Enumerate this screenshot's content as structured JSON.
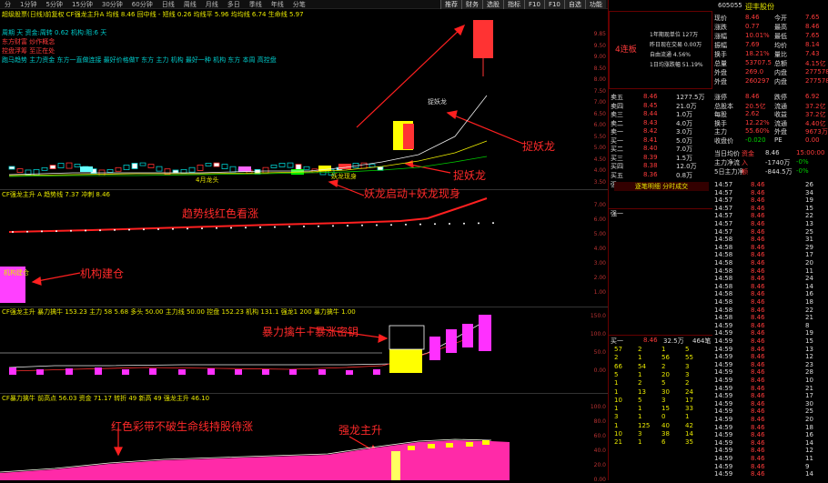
{
  "topbar": {
    "tabs": [
      "分",
      "1分钟",
      "5分钟",
      "15分钟",
      "30分钟",
      "60分钟",
      "日线",
      "周线",
      "月线",
      "多日",
      "季线",
      "年线",
      "分笔",
      "盘面",
      "更多"
    ]
  },
  "toolbar": [
    "推荐",
    "财务",
    "选股",
    "指标",
    "F10",
    "F10",
    "自选",
    "功能"
  ],
  "stock": {
    "code": "605055",
    "name": "迎丰股份"
  },
  "main_legend": {
    "line1": "超级股票(日线)前复权 CF强龙主升A 均线 8.46 回中线 - 短线 0.26 均线平 5.96 均均线 6.74 生命线 5.97",
    "lines": [
      "周期 天 资金:周转 0.62 机构:阻:6 天",
      "东方财富 炒作概念",
      "控盘浮筹 至正在处",
      "跑马趋势 主力资金 东方一直做连接 最好价格做T 东方 主力 机构 最好一种 机构 东方 本周 高控盘"
    ]
  },
  "price_axis": [
    "9.85",
    "9.50",
    "9.00",
    "8.50",
    "8.00",
    "7.50",
    "7.00",
    "6.50",
    "6.00",
    "5.50",
    "5.00",
    "4.50",
    "4.00",
    "3.50"
  ],
  "sub1_legend": "CF强龙主升 A 趋势线 7.37 冲刺 8.46",
  "sub1_axis": [
    "7.00",
    "6.00",
    "5.00",
    "4.00",
    "3.00",
    "2.00",
    "1.00"
  ],
  "sub2_legend": "CF强龙主升 暴力擒牛 153.23 主力 58 5.68 多头 50.00 主力线 50.00 控盘 152.23 机构 131.1 强龙1 200 暴力擒牛 1.00",
  "sub2_axis": [
    "150.0",
    "100.0",
    "50.0",
    "0.00"
  ],
  "sub3_legend": "CF暴力擒牛 前高点 56.03 资金 71.17 转折 49 新高 49 强龙主升 46.10",
  "sub3_axis": [
    "100.0",
    "80.0",
    "60.0",
    "40.0",
    "20.0",
    "0.00"
  ],
  "annotations": {
    "zhuoyaolong": "捉妖龙",
    "yaolongqidong": "妖龙启动+妖龙现身",
    "qushixian": "趋势线红色看涨",
    "jigoujiancang": "机构建仓",
    "baoli": "暴力擒牛+暴涨密钥",
    "hongse": "红色彩带不破生命线持股待涨",
    "qianglong": "强龙主升",
    "chart_small1": "4月龙头",
    "chart_small2": "妖龙现身",
    "chart_small3": "主力建仓",
    "chart_small4": "机构建仓",
    "zhuoyaolong_small": "捉妖龙",
    "tag_zhangting": "4连板"
  },
  "right": {
    "header_left": {
      "label": "4连板"
    },
    "header_info": [
      "1年期现单位 127万",
      "昨日现在交易 0.00万",
      "自由流通 4.56%",
      "1日均涨跌幅 51.19%"
    ],
    "quote": [
      [
        "现价",
        "8.46",
        "今开",
        "7.65"
      ],
      [
        "涨跌",
        "0.77",
        "最高",
        "8.46"
      ],
      [
        "涨幅",
        "10.01%",
        "最低",
        "7.65"
      ],
      [
        "振幅",
        "7.69",
        "均价",
        "8.14"
      ],
      [
        "换手",
        "18.21%",
        "量比",
        "7.43"
      ],
      [
        "总量",
        "53707.5",
        "总额",
        "4.15亿"
      ],
      [
        "外盘",
        "269.0",
        "内盘",
        "277578"
      ],
      [
        "外盘",
        "260297",
        "内盘",
        "277578"
      ]
    ],
    "asks": [
      [
        "卖五",
        "8.46",
        "1277.5万"
      ],
      [
        "卖四",
        "8.45",
        "21.0万"
      ],
      [
        "卖三",
        "8.44",
        "1.0万"
      ],
      [
        "卖二",
        "8.43",
        "4.0万"
      ],
      [
        "卖一",
        "8.42",
        "3.0万"
      ],
      [
        "买一",
        "8.41",
        "5.0万"
      ],
      [
        "买二",
        "8.40",
        "7.0万"
      ],
      [
        "买三",
        "8.39",
        "1.5万"
      ],
      [
        "买四",
        "8.38",
        "12.0万"
      ],
      [
        "买五",
        "8.36",
        "0.8万"
      ]
    ],
    "stats": [
      [
        "涨停",
        "8.46",
        "跌停",
        "6.92"
      ],
      [
        "总股本",
        "20.5亿",
        "流通",
        "37.2亿"
      ],
      [
        "每股",
        "2.62",
        "收益",
        "37.2亿"
      ],
      [
        "换手",
        "12.22%",
        "流通",
        "4.40亿"
      ],
      [
        "主力",
        "55.60%",
        "外盘",
        "9673万"
      ],
      [
        "收盘价",
        "-0.020",
        "PE",
        "0.00"
      ]
    ],
    "stats2": [
      [
        "当日均价",
        "资金",
        "8.46",
        "15:00:00"
      ],
      [
        "主力净流",
        "入",
        "-1740万",
        "-0%"
      ],
      [
        "5日主力净",
        "额",
        "-844.5万",
        "-0%"
      ]
    ],
    "tradetab": "逐笔明细 分时成交",
    "ticks_time": [
      "14:57",
      "14:57",
      "14:57",
      "14:57",
      "14:57",
      "14:57",
      "14:57",
      "14:58",
      "14:58",
      "14:58",
      "14:58",
      "14:58",
      "14:58",
      "14:58",
      "14:58",
      "14:58",
      "14:58",
      "14:58",
      "14:59",
      "14:59",
      "14:59",
      "14:59",
      "14:59",
      "14:59",
      "14:59",
      "14:59",
      "14:59",
      "14:59",
      "14:59",
      "14:59",
      "14:59",
      "14:59",
      "14:59",
      "14:59",
      "14:59",
      "14:59",
      "14:59",
      "14:59"
    ],
    "ticks_price": "8.46",
    "ticks_vol": [
      "26",
      "34",
      "19",
      "15",
      "22",
      "13",
      "25",
      "31",
      "29",
      "17",
      "20",
      "11",
      "24",
      "14",
      "16",
      "18",
      "22",
      "21",
      "8",
      "19",
      "15",
      "13",
      "12",
      "23",
      "28",
      "10",
      "21",
      "17",
      "30",
      "25",
      "20",
      "18",
      "16",
      "14",
      "12",
      "11",
      "9",
      "14"
    ],
    "mid_label": "强一",
    "bid_box": {
      "title": "买一",
      "price": "8.46",
      "vol": "32.5万",
      "count": "464笔"
    },
    "bid_grid": [
      [
        "57",
        "2",
        "1",
        "5"
      ],
      [
        "2",
        "1",
        "56",
        "55"
      ],
      [
        "66",
        "54",
        "2",
        "3"
      ],
      [
        "5",
        "1",
        "20",
        "3"
      ],
      [
        "1",
        "2",
        "5",
        "2"
      ],
      [
        "1",
        "13",
        "30",
        "24"
      ],
      [
        "10",
        "5",
        "3",
        "17"
      ],
      [
        "1",
        "1",
        "15",
        "33"
      ],
      [
        "3",
        "1",
        "0",
        "1"
      ],
      [
        "1",
        "125",
        "40",
        "42"
      ],
      [
        "10",
        "3",
        "38",
        "14"
      ],
      [
        "21",
        "1",
        "6",
        "35"
      ]
    ]
  }
}
